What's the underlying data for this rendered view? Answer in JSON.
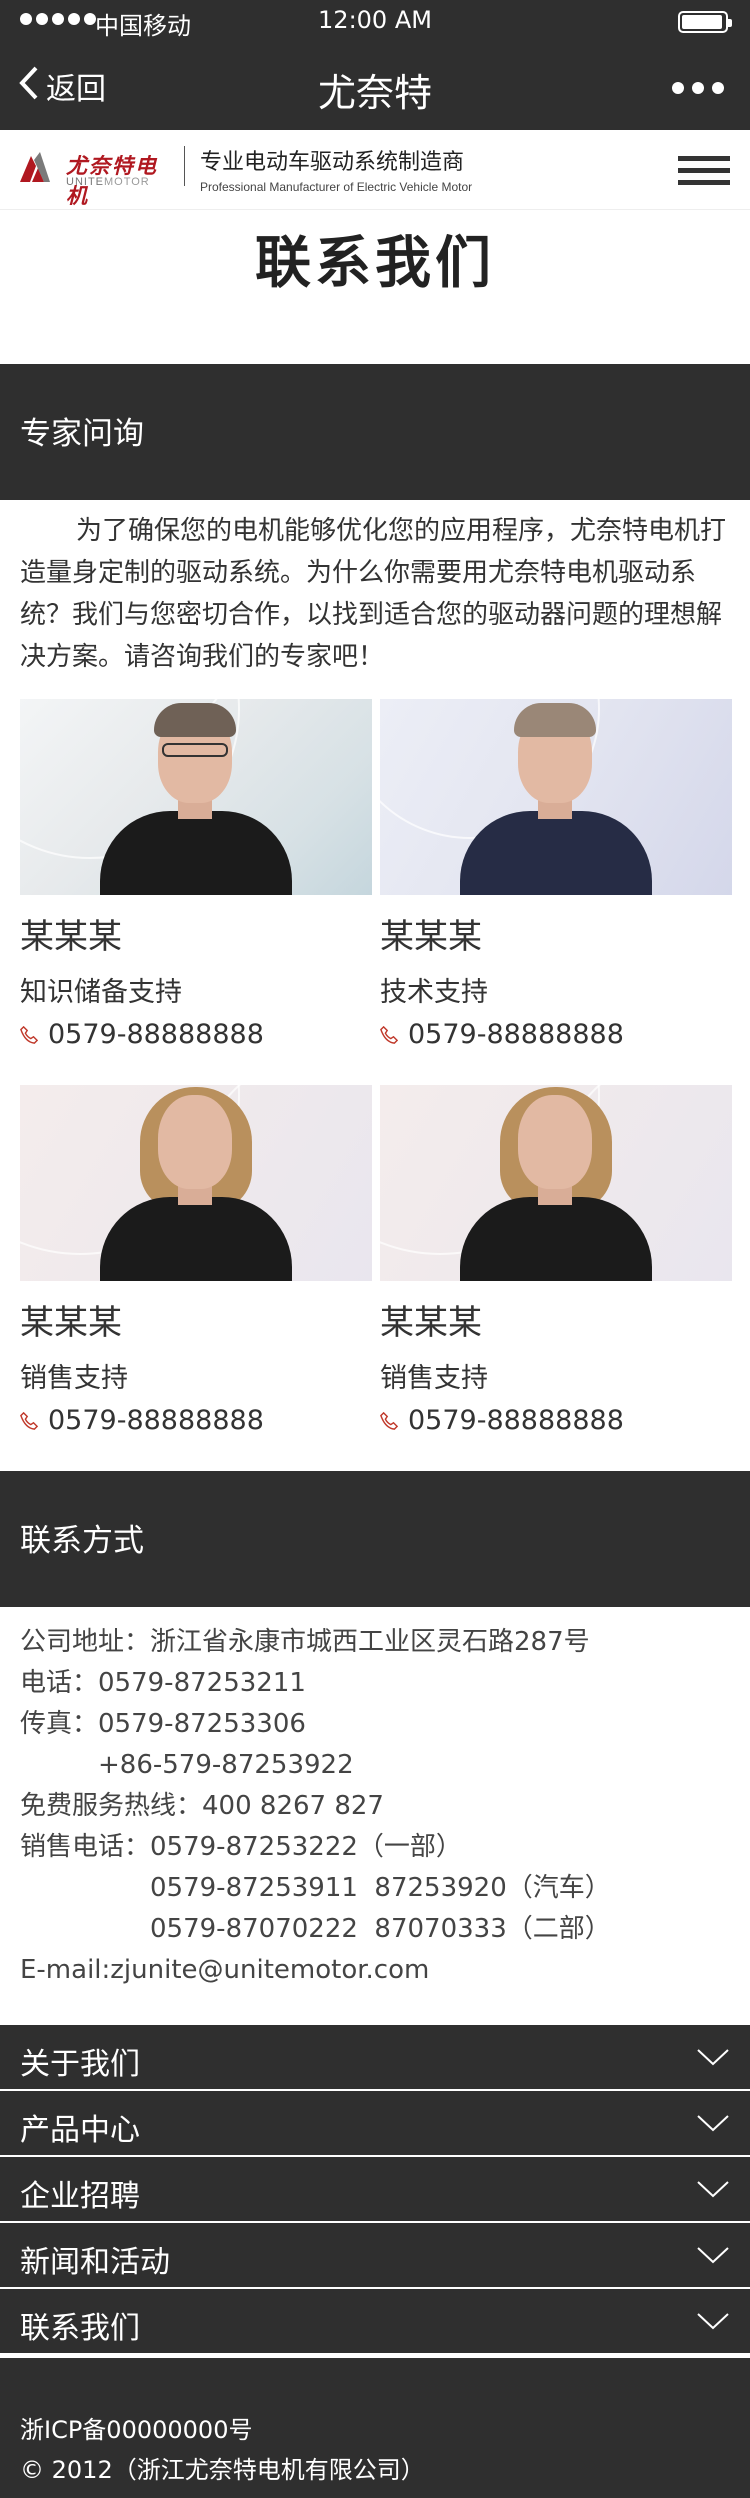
{
  "status_bar": {
    "carrier": "中国移动",
    "time": "12:00 AM"
  },
  "nav": {
    "back_label": "返回",
    "title": "尤奈特"
  },
  "brand": {
    "logo_cn": "尤奈特电机",
    "logo_en_a": "UNITE",
    "logo_en_b": "MOTOR",
    "slogan_cn": "专业电动车驱动系统制造商",
    "slogan_en": "Professional Manufacturer of Electric Vehicle Motor"
  },
  "page_title": "联系我们",
  "experts_section": {
    "heading": "专家问询",
    "intro": "为了确保您的电机能够优化您的应用程序，尤奈特电机打造量身定制的驱动系统。为什么你需要用尤奈特电机驱动系统？我们与您密切合作，以找到适合您的驱动器问题的理想解决方案。请咨询我们的专家吧！",
    "experts": [
      {
        "name": "某某某",
        "role": "知识储备支持",
        "phone": "0579-88888888"
      },
      {
        "name": "某某某",
        "role": "技术支持",
        "phone": "0579-88888888"
      },
      {
        "name": "某某某",
        "role": "销售支持",
        "phone": "0579-88888888"
      },
      {
        "name": "某某某",
        "role": "销售支持",
        "phone": "0579-88888888"
      }
    ]
  },
  "contact_section": {
    "heading": "联系方式",
    "address_label": "公司地址：",
    "address": "浙江省永康市城西工业区灵石路287号",
    "tel_label": "电话：",
    "tel": "0579-87253211",
    "fax_label": "传真：",
    "fax": [
      "0579-87253306",
      "+86-579-87253922"
    ],
    "hotline_label": "免费服务热线：",
    "hotline": "400 8267 827",
    "sales_label": "销售电话：",
    "sales": [
      "0579-87253222（一部）",
      "0579-87253911  87253920（汽车）",
      "0579-87070222  87070333（二部）"
    ],
    "email_label": "E-mail:",
    "email": "zjunite@unitemotor.com"
  },
  "accordion": [
    {
      "label": "关于我们"
    },
    {
      "label": "产品中心"
    },
    {
      "label": "企业招聘"
    },
    {
      "label": "新闻和活动"
    },
    {
      "label": "联系我们"
    }
  ],
  "footer": {
    "icp": "浙ICP备00000000号",
    "copyright": "© 2012（浙江尤奈特电机有限公司）"
  },
  "colors": {
    "dark_bar": "#2f2f2f",
    "brand_red": "#b01820",
    "phone_icon": "#c0392b"
  },
  "icons": [
    "signal-dots-icon",
    "battery-icon",
    "chevron-left-icon",
    "more-dots-icon",
    "menu-icon",
    "phone-icon",
    "chevron-down-icon"
  ]
}
